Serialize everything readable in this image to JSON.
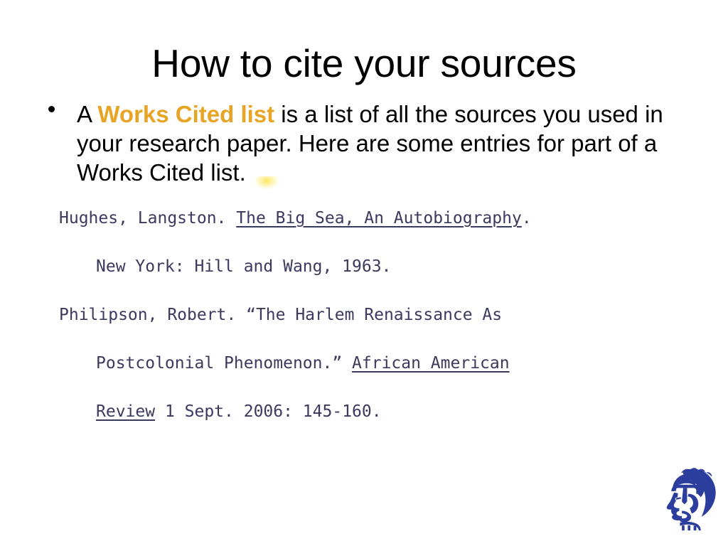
{
  "slide": {
    "title": "How to cite your sources",
    "background_color": "#FFFFFF"
  },
  "bullet": {
    "marker": "•",
    "lead_text": "A ",
    "highlight_text": "Works Cited list",
    "highlight_color": "#E8A424",
    "rest_text": " is a list of all the sources you used in your research paper. Here are some entries for part of a Works Cited list."
  },
  "citations": {
    "text_color": "#3A3A5E",
    "lines": [
      {
        "indent": false,
        "segments": [
          {
            "text": "Hughes, Langston. ",
            "underline": false
          },
          {
            "text": "The Big Sea, An Autobiography",
            "underline": true
          },
          {
            "text": ".",
            "underline": false
          }
        ]
      },
      {
        "indent": true,
        "segments": [
          {
            "text": "New York: Hill and Wang, 1963.",
            "underline": false
          }
        ]
      },
      {
        "indent": false,
        "segments": [
          {
            "text": "Philipson, Robert. “The Harlem Renaissance As",
            "underline": false
          }
        ]
      },
      {
        "indent": true,
        "segments": [
          {
            "text": "Postcolonial Phenomenon.” ",
            "underline": false
          },
          {
            "text": "African American",
            "underline": true
          }
        ]
      },
      {
        "indent": true,
        "segments": [
          {
            "text": "Review",
            "underline": true
          },
          {
            "text": " 1 Sept. 2006: 145-160.",
            "underline": false
          }
        ]
      }
    ]
  },
  "logo": {
    "name": "spartan-warrior-head",
    "color": "#2B3E9E",
    "outline_color": "#2B3E9E"
  }
}
